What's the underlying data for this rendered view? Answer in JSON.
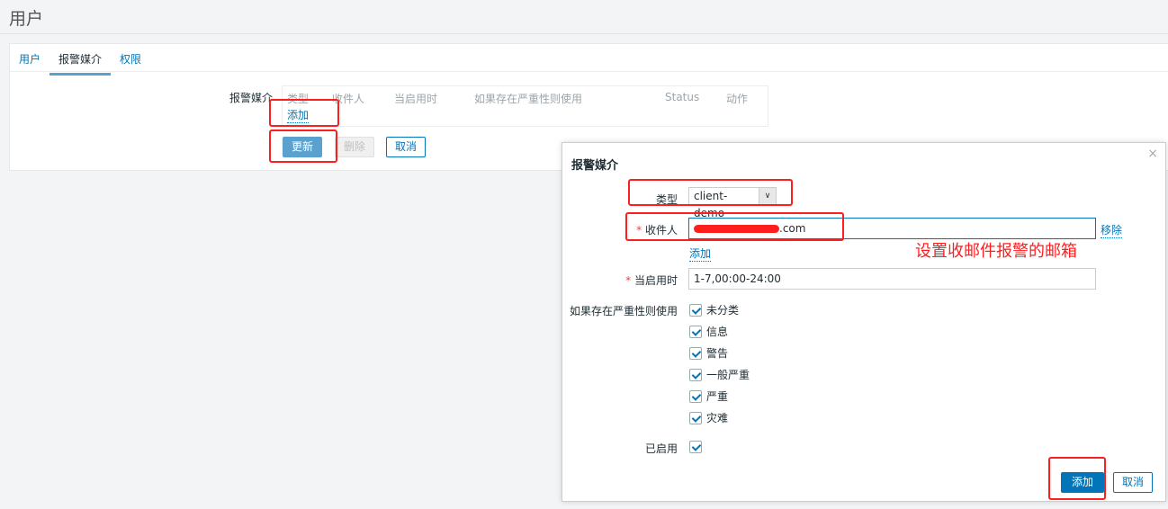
{
  "page": {
    "title": "用户"
  },
  "tabs": [
    "用户",
    "报警媒介",
    "权限"
  ],
  "media": {
    "label": "报警媒介",
    "columns": [
      "类型",
      "收件人",
      "当启用时",
      "如果存在严重性则使用",
      "Status",
      "动作"
    ],
    "add": "添加"
  },
  "buttons": {
    "update": "更新",
    "delete": "删除",
    "cancel": "取消"
  },
  "dialog": {
    "title": "报警媒介",
    "close": "×",
    "type_label": "类型",
    "type_value": "client-demo",
    "recipient_label": "收件人",
    "recipient_value": ".com",
    "remove": "移除",
    "add_recipient": "添加",
    "when_label": "当启用时",
    "when_value": "1-7,00:00-24:00",
    "severity_label": "如果存在严重性则使用",
    "severities": [
      "未分类",
      "信息",
      "警告",
      "一般严重",
      "严重",
      "灾难"
    ],
    "enabled_label": "已启用",
    "add": "添加",
    "cancel": "取消",
    "required": "*"
  },
  "annotation": "设置收邮件报警的邮箱"
}
